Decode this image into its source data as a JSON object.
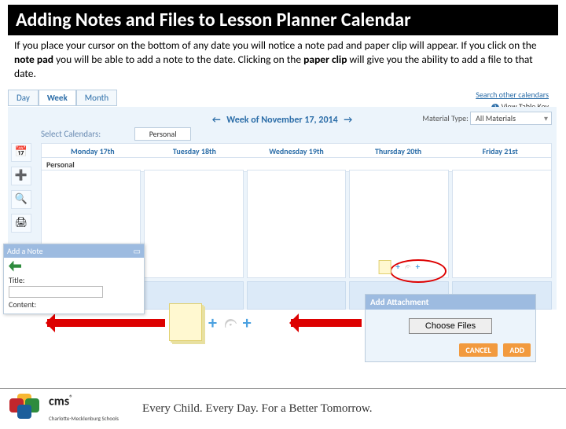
{
  "title": "Adding Notes and Files to Lesson Planner Calendar",
  "body_html": "If you place your cursor on the bottom of any date you will notice a note pad and paper clip will appear. If you click on the <b>note pad</b> you will be able to add a note to the date. Clicking on the <b>paper clip</b> will give you the ability to add a file to that date.",
  "view_tabs": {
    "day": "Day",
    "week": "Week",
    "month": "Month",
    "active": "Week"
  },
  "top_right": {
    "search": "Search other calendars",
    "key": "View Table Key"
  },
  "week_label": "Week of November 17, 2014",
  "material_type": {
    "label": "Material Type:",
    "value": "All Materials"
  },
  "select_calendars": {
    "label": "Select Calendars:",
    "chip": "Personal"
  },
  "days": [
    "Monday 17th",
    "Tuesday 18th",
    "Wednesday 19th",
    "Thursday 20th",
    "Friday 21st"
  ],
  "personal_row": "Personal",
  "add_note": {
    "header": "Add a Note",
    "title_label": "Title:",
    "content_label": "Content:"
  },
  "add_attachment": {
    "header": "Add Attachment",
    "choose": "Choose Files",
    "cancel": "CANCEL",
    "add": "ADD"
  },
  "footer": {
    "brand": "cms",
    "brand_sub": "Charlotte-Mecklenburg Schools",
    "tagline": "Every Child. Every Day. For a Better Tomorrow."
  }
}
